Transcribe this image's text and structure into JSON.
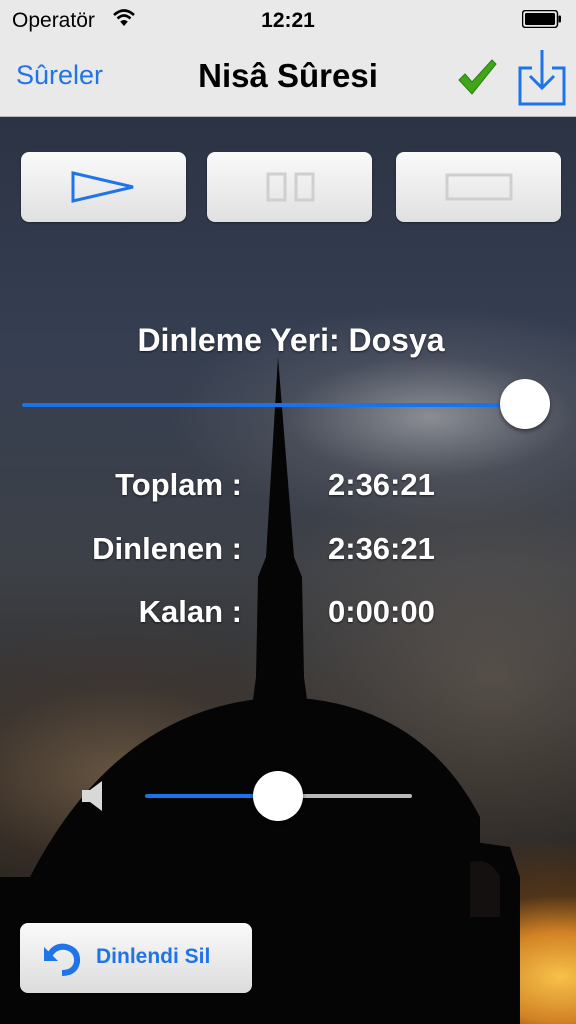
{
  "status_bar": {
    "carrier": "Operatör",
    "time": "12:21"
  },
  "nav": {
    "back_label": "Sûreler",
    "title": "Nisâ Sûresi"
  },
  "player": {
    "source_label": "Dinleme Yeri: Dosya",
    "progress_fraction": 1.0,
    "volume_fraction": 0.5,
    "stats": [
      {
        "label": "Toplam :",
        "value": "2:36:21"
      },
      {
        "label": "Dinlenen :",
        "value": "2:36:21"
      },
      {
        "label": "Kalan :",
        "value": "0:00:00"
      }
    ]
  },
  "delete_button": {
    "label": "Dinlendi Sil"
  },
  "icons": {
    "play": "play-icon",
    "pause": "pause-icon",
    "stop": "stop-icon",
    "check": "checkmark-icon",
    "download": "download-icon",
    "volume": "speaker-icon",
    "undo": "undo-icon"
  },
  "colors": {
    "accent": "#1f74e8",
    "check": "#3fa619"
  }
}
